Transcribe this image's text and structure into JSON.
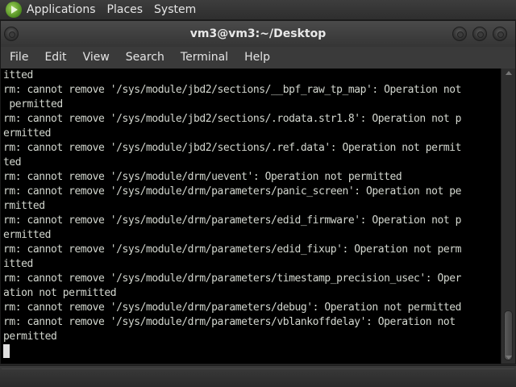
{
  "panel": {
    "logo_icon": "distro-logo-icon",
    "menus": [
      "Applications",
      "Places",
      "System"
    ]
  },
  "window": {
    "title": "vm3@vm3:~/Desktop",
    "menus": [
      "File",
      "Edit",
      "View",
      "Search",
      "Terminal",
      "Help"
    ]
  },
  "terminal": {
    "lines": [
      "itted",
      "rm: cannot remove '/sys/module/jbd2/sections/__bpf_raw_tp_map': Operation not",
      " permitted",
      "rm: cannot remove '/sys/module/jbd2/sections/.rodata.str1.8': Operation not p",
      "ermitted",
      "rm: cannot remove '/sys/module/jbd2/sections/.ref.data': Operation not permit",
      "ted",
      "rm: cannot remove '/sys/module/drm/uevent': Operation not permitted",
      "rm: cannot remove '/sys/module/drm/parameters/panic_screen': Operation not pe",
      "rmitted",
      "rm: cannot remove '/sys/module/drm/parameters/edid_firmware': Operation not p",
      "ermitted",
      "rm: cannot remove '/sys/module/drm/parameters/edid_fixup': Operation not perm",
      "itted",
      "rm: cannot remove '/sys/module/drm/parameters/timestamp_precision_usec': Oper",
      "ation not permitted",
      "rm: cannot remove '/sys/module/drm/parameters/debug': Operation not permitted",
      "rm: cannot remove '/sys/module/drm/parameters/vblankoffdelay': Operation not",
      "permitted"
    ]
  },
  "colors": {
    "terminal_bg": "#000000",
    "terminal_fg": "#d3d7cf",
    "chrome": "#3a3a3a"
  }
}
